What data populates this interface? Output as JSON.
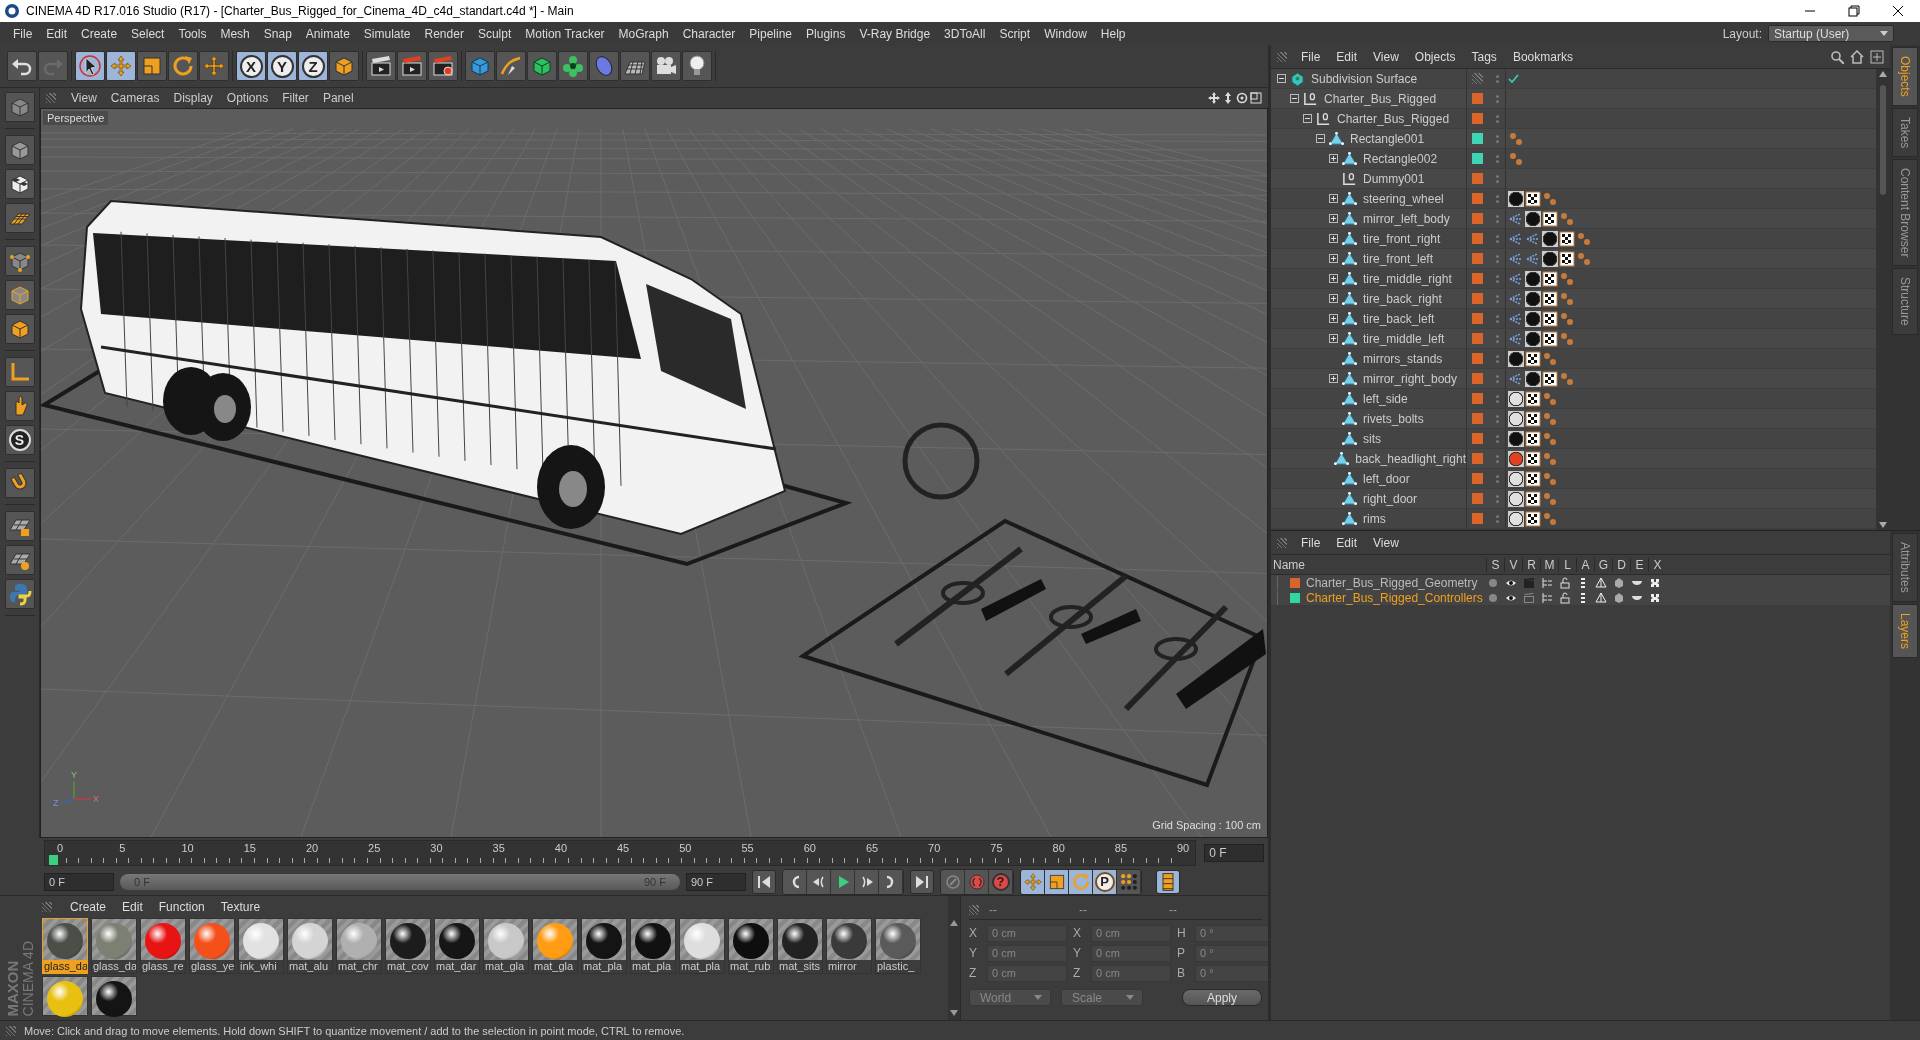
{
  "window": {
    "title": "CINEMA 4D R17.016 Studio (R17) - [Charter_Bus_Rigged_for_Cinema_4D_c4d_standart.c4d *] - Main"
  },
  "menu": [
    "File",
    "Edit",
    "Create",
    "Select",
    "Tools",
    "Mesh",
    "Snap",
    "Animate",
    "Simulate",
    "Render",
    "Sculpt",
    "Motion Tracker",
    "MoGraph",
    "Character",
    "Pipeline",
    "Plugins",
    "V-Ray Bridge",
    "3DToAll",
    "Script",
    "Window",
    "Help"
  ],
  "layout": {
    "label": "Layout:",
    "value": "Startup (User)"
  },
  "toolbar": [
    [
      {
        "kind": "undo",
        "selected": false
      },
      {
        "kind": "redo",
        "selected": false
      }
    ],
    [
      {
        "kind": "select",
        "selected": true
      },
      {
        "kind": "move",
        "selected": true
      },
      {
        "kind": "scale",
        "selected": false
      },
      {
        "kind": "rotate",
        "selected": false
      },
      {
        "kind": "transform",
        "selected": false
      }
    ],
    [
      {
        "kind": "axis",
        "label": "X",
        "selected": true
      },
      {
        "kind": "axis",
        "label": "Y",
        "selected": true
      },
      {
        "kind": "axis",
        "label": "Z",
        "selected": true
      },
      {
        "kind": "coord",
        "selected": false
      }
    ],
    [
      {
        "kind": "render",
        "selected": false
      },
      {
        "kind": "render_view",
        "selected": false
      },
      {
        "kind": "render_settings",
        "selected": false
      }
    ],
    [
      {
        "kind": "cube",
        "selected": false
      },
      {
        "kind": "pen",
        "selected": false
      },
      {
        "kind": "subdiv",
        "selected": false
      },
      {
        "kind": "cloner",
        "selected": false
      },
      {
        "kind": "deformer",
        "selected": false
      },
      {
        "kind": "floor",
        "selected": false
      },
      {
        "kind": "camera",
        "selected": false
      },
      {
        "kind": "light",
        "selected": false
      }
    ]
  ],
  "left_tools": [
    [
      {
        "kind": "make_editable"
      }
    ],
    [
      {
        "kind": "model"
      },
      {
        "kind": "texture"
      },
      {
        "kind": "workplane"
      }
    ],
    [
      {
        "kind": "points"
      },
      {
        "kind": "edges"
      },
      {
        "kind": "polygons"
      }
    ],
    [
      {
        "kind": "axis_mode"
      },
      {
        "kind": "tweak"
      },
      {
        "kind": "soft",
        "label": "S"
      }
    ],
    [
      {
        "kind": "magnet"
      }
    ],
    [
      {
        "kind": "gridsnap"
      },
      {
        "kind": "lock"
      },
      {
        "kind": "python"
      }
    ]
  ],
  "viewport": {
    "menu": [
      "View",
      "Cameras",
      "Display",
      "Options",
      "Filter",
      "Panel"
    ],
    "camera": "Perspective",
    "grid_spacing": "Grid Spacing : 100 cm",
    "axis_labels": [
      "Y",
      "Z",
      "X"
    ]
  },
  "timeline": {
    "ticks": [
      "0",
      "5",
      "10",
      "15",
      "20",
      "25",
      "30",
      "35",
      "40",
      "45",
      "50",
      "55",
      "60",
      "65",
      "70",
      "75",
      "80",
      "85",
      "90"
    ],
    "playhead": {
      "level": 0
    },
    "frame_field": "0 F"
  },
  "transport": {
    "start": "0 F",
    "range": {
      "start": "0 F",
      "end": "90 F",
      "level": 1
    },
    "end": "90 F",
    "help_label": "?",
    "modes": [
      {
        "kind": "move",
        "on": true
      },
      {
        "kind": "scale",
        "on": true
      },
      {
        "kind": "rotate",
        "on": true
      },
      {
        "kind": "param",
        "label": "P",
        "on": true
      },
      {
        "kind": "dots",
        "on": false
      }
    ],
    "film_on": true
  },
  "materials": {
    "menu": [
      "Create",
      "Edit",
      "Function",
      "Texture"
    ],
    "logo": [
      "MAXON",
      "CINEMA 4D"
    ],
    "items": [
      {
        "name": "glass_da",
        "color": "#4b4f48",
        "selected": true
      },
      {
        "name": "glass_da",
        "color": "#7c8072",
        "selected": false
      },
      {
        "name": "glass_re",
        "color": "#e81414",
        "selected": false
      },
      {
        "name": "glass_ye",
        "color": "#f4501a",
        "selected": false
      },
      {
        "name": "ink_whi",
        "color": "#e2e2e2",
        "selected": false
      },
      {
        "name": "mat_alu",
        "color": "#d4d4d4",
        "selected": false
      },
      {
        "name": "mat_chr",
        "color": "#b0b0b0",
        "selected": false
      },
      {
        "name": "mat_cov",
        "color": "#1c1c1c",
        "selected": false
      },
      {
        "name": "mat_dar",
        "color": "#161616",
        "selected": false
      },
      {
        "name": "mat_gla",
        "color": "#c8c8c8",
        "selected": false
      },
      {
        "name": "mat_gla",
        "color": "#ff9c14",
        "selected": false
      },
      {
        "name": "mat_pla",
        "color": "#141414",
        "selected": false
      },
      {
        "name": "mat_pla",
        "color": "#111111",
        "selected": false
      },
      {
        "name": "mat_pla",
        "color": "#dedede",
        "selected": false
      },
      {
        "name": "mat_rub",
        "color": "#0e0e0e",
        "selected": false
      },
      {
        "name": "mat_sits",
        "color": "#222222",
        "selected": false
      },
      {
        "name": "mirror",
        "color": "#3a3a3a",
        "selected": false
      },
      {
        "name": "plastic_",
        "color": "#5a5a5a",
        "selected": false
      },
      {
        "color": "#e8c010",
        "selected": false
      },
      {
        "color": "#141414",
        "selected": false
      }
    ]
  },
  "coordinates": {
    "headers": [
      "--",
      "--",
      "--"
    ],
    "rows": [
      {
        "p_axis": "X",
        "p": "0 cm",
        "s_axis": "X",
        "s": "0 cm",
        "r_axis": "H",
        "r": "0 °"
      },
      {
        "p_axis": "Y",
        "p": "0 cm",
        "s_axis": "Y",
        "s": "0 cm",
        "r_axis": "P",
        "r": "0 °"
      },
      {
        "p_axis": "Z",
        "p": "0 cm",
        "s_axis": "Z",
        "s": "0 cm",
        "r_axis": "B",
        "r": "0 °"
      }
    ],
    "space": "World",
    "mode": "Scale",
    "apply": "Apply"
  },
  "objects": {
    "menu": [
      "File",
      "Edit",
      "View",
      "Objects",
      "Tags",
      "Bookmarks"
    ],
    "tree": [
      {
        "name": "Subdivision Surface",
        "kind": "subdiv",
        "expanded": true,
        "enabled": true,
        "children": [
          {
            "name": "Charter_Bus_Rigged",
            "kind": "null",
            "expanded": true,
            "color": "#d9652b",
            "children": [
              {
                "name": "Charter_Bus_Rigged",
                "kind": "null",
                "expanded": true,
                "color": "#d9652b",
                "children": [
                  {
                    "name": "Rectangle001",
                    "kind": "poly",
                    "expanded": true,
                    "color": "#3fd4b4",
                    "tags": [
                      {
                        "kind": "weight"
                      }
                    ],
                    "children": [
                      {
                        "name": "Rectangle002",
                        "kind": "poly",
                        "expanded": false,
                        "color": "#3fd4b4",
                        "tags": [
                          {
                            "kind": "weight"
                          }
                        ]
                      },
                      {
                        "name": "Dummy001",
                        "kind": "null",
                        "color": "#d9652b"
                      },
                      {
                        "name": "steering_wheel",
                        "kind": "poly",
                        "expanded": false,
                        "color": "#d9652b",
                        "tags": [
                          {
                            "kind": "material",
                            "color": "#111111"
                          },
                          {
                            "kind": "uvw"
                          },
                          {
                            "kind": "weight"
                          }
                        ]
                      },
                      {
                        "name": "mirror_left_body",
                        "kind": "poly",
                        "expanded": false,
                        "color": "#d9652b",
                        "tags": [
                          {
                            "kind": "constraint"
                          },
                          {
                            "kind": "material",
                            "color": "#111111"
                          },
                          {
                            "kind": "uvw"
                          },
                          {
                            "kind": "weight"
                          }
                        ]
                      },
                      {
                        "name": "tire_front_right",
                        "kind": "poly",
                        "expanded": false,
                        "color": "#d9652b",
                        "tags": [
                          {
                            "kind": "constraint"
                          },
                          {
                            "kind": "constraint"
                          },
                          {
                            "kind": "material",
                            "color": "#111111"
                          },
                          {
                            "kind": "uvw"
                          },
                          {
                            "kind": "weight"
                          }
                        ]
                      },
                      {
                        "name": "tire_front_left",
                        "kind": "poly",
                        "expanded": false,
                        "color": "#d9652b",
                        "tags": [
                          {
                            "kind": "constraint"
                          },
                          {
                            "kind": "constraint"
                          },
                          {
                            "kind": "material",
                            "color": "#111111"
                          },
                          {
                            "kind": "uvw"
                          },
                          {
                            "kind": "weight"
                          }
                        ]
                      },
                      {
                        "name": "tire_middle_right",
                        "kind": "poly",
                        "expanded": false,
                        "color": "#d9652b",
                        "tags": [
                          {
                            "kind": "constraint"
                          },
                          {
                            "kind": "material",
                            "color": "#111111"
                          },
                          {
                            "kind": "uvw"
                          },
                          {
                            "kind": "weight"
                          }
                        ]
                      },
                      {
                        "name": "tire_back_right",
                        "kind": "poly",
                        "expanded": false,
                        "color": "#d9652b",
                        "tags": [
                          {
                            "kind": "constraint"
                          },
                          {
                            "kind": "material",
                            "color": "#111111"
                          },
                          {
                            "kind": "uvw"
                          },
                          {
                            "kind": "weight"
                          }
                        ]
                      },
                      {
                        "name": "tire_back_left",
                        "kind": "poly",
                        "expanded": false,
                        "color": "#d9652b",
                        "tags": [
                          {
                            "kind": "constraint"
                          },
                          {
                            "kind": "material",
                            "color": "#111111"
                          },
                          {
                            "kind": "uvw"
                          },
                          {
                            "kind": "weight"
                          }
                        ]
                      },
                      {
                        "name": "tire_middle_left",
                        "kind": "poly",
                        "expanded": false,
                        "color": "#d9652b",
                        "tags": [
                          {
                            "kind": "constraint"
                          },
                          {
                            "kind": "material",
                            "color": "#111111"
                          },
                          {
                            "kind": "uvw"
                          },
                          {
                            "kind": "weight"
                          }
                        ]
                      },
                      {
                        "name": "mirrors_stands",
                        "kind": "poly",
                        "color": "#d9652b",
                        "tags": [
                          {
                            "kind": "material",
                            "color": "#111111"
                          },
                          {
                            "kind": "uvw"
                          },
                          {
                            "kind": "weight"
                          }
                        ]
                      },
                      {
                        "name": "mirror_right_body",
                        "kind": "poly",
                        "expanded": false,
                        "color": "#d9652b",
                        "tags": [
                          {
                            "kind": "constraint"
                          },
                          {
                            "kind": "material",
                            "color": "#111111"
                          },
                          {
                            "kind": "uvw"
                          },
                          {
                            "kind": "weight"
                          }
                        ]
                      },
                      {
                        "name": "left_side",
                        "kind": "poly",
                        "color": "#d9652b",
                        "tags": [
                          {
                            "kind": "material",
                            "color": "#e0e0e0"
                          },
                          {
                            "kind": "uvw"
                          },
                          {
                            "kind": "weight"
                          }
                        ]
                      },
                      {
                        "name": "rivets_bolts",
                        "kind": "poly",
                        "color": "#d9652b",
                        "tags": [
                          {
                            "kind": "material",
                            "color": "#e0e0e0"
                          },
                          {
                            "kind": "uvw"
                          },
                          {
                            "kind": "weight"
                          }
                        ]
                      },
                      {
                        "name": "sits",
                        "kind": "poly",
                        "color": "#d9652b",
                        "tags": [
                          {
                            "kind": "material",
                            "color": "#111111"
                          },
                          {
                            "kind": "uvw"
                          },
                          {
                            "kind": "weight"
                          }
                        ]
                      },
                      {
                        "name": "back_headlight_right",
                        "kind": "poly",
                        "color": "#d9652b",
                        "tags": [
                          {
                            "kind": "material",
                            "color": "#e2401e"
                          },
                          {
                            "kind": "uvw"
                          },
                          {
                            "kind": "weight"
                          }
                        ]
                      },
                      {
                        "name": "left_door",
                        "kind": "poly",
                        "color": "#d9652b",
                        "tags": [
                          {
                            "kind": "material",
                            "color": "#e0e0e0"
                          },
                          {
                            "kind": "uvw"
                          },
                          {
                            "kind": "weight"
                          }
                        ]
                      },
                      {
                        "name": "right_door",
                        "kind": "poly",
                        "color": "#d9652b",
                        "tags": [
                          {
                            "kind": "material",
                            "color": "#e0e0e0"
                          },
                          {
                            "kind": "uvw"
                          },
                          {
                            "kind": "weight"
                          }
                        ]
                      },
                      {
                        "name": "rims",
                        "kind": "poly",
                        "color": "#d9652b",
                        "tags": [
                          {
                            "kind": "material",
                            "color": "#e0e0e0"
                          },
                          {
                            "kind": "uvw"
                          },
                          {
                            "kind": "weight"
                          }
                        ]
                      }
                    ]
                  }
                ]
              }
            ]
          }
        ]
      }
    ]
  },
  "layers": {
    "menu": [
      "File",
      "Edit",
      "View"
    ],
    "columns": [
      "Name",
      "S",
      "V",
      "R",
      "M",
      "L",
      "A",
      "G",
      "D",
      "E",
      "X"
    ],
    "rows": [
      {
        "name": "Charter_Bus_Rigged_Geometry",
        "color": "#d9652b",
        "selected": false,
        "render": true
      },
      {
        "name": "Charter_Bus_Rigged_Controllers",
        "color": "#2ed8a0",
        "selected": true,
        "render": false
      }
    ]
  },
  "side_tabs": {
    "top": [
      {
        "label": "Objects",
        "selected": true
      },
      {
        "label": "Takes",
        "selected": false
      },
      {
        "label": "Content Browser",
        "selected": false
      },
      {
        "label": "Structure",
        "selected": false
      }
    ],
    "bottom": [
      {
        "label": "Attributes",
        "selected": false
      },
      {
        "label": "Layers",
        "selected": true
      }
    ]
  },
  "status": "Move: Click and drag to move elements. Hold down SHIFT to quantize movement / add to the selection in point mode, CTRL to remove."
}
